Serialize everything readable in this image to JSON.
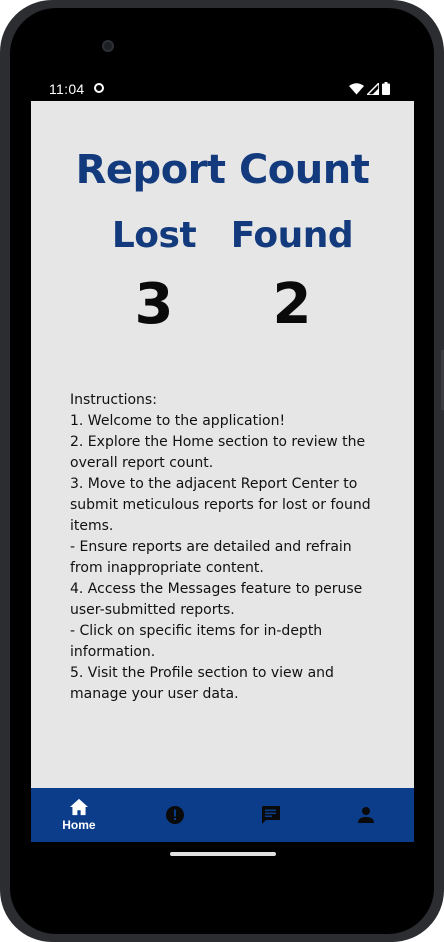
{
  "status_bar": {
    "time": "11:04"
  },
  "main": {
    "title": "Report Count",
    "lost": {
      "label": "Lost",
      "count": "3"
    },
    "found": {
      "label": "Found",
      "count": "2"
    }
  },
  "instructions": {
    "lines": [
      "Instructions:",
      "1. Welcome to the application!",
      "2. Explore the Home section to review the overall report count.",
      "3. Move to the adjacent Report Center to submit meticulous reports for lost or found items.",
      "- Ensure reports are detailed and refrain from inappropriate content.",
      "4. Access the Messages feature to peruse user-submitted reports.",
      "- Click on specific items for in-depth information.",
      "5. Visit the Profile section to view and manage your user data."
    ]
  },
  "bottom_nav": {
    "items": [
      {
        "icon": "home-icon",
        "label": "Home",
        "active": true
      },
      {
        "icon": "report-icon",
        "label": "",
        "active": false
      },
      {
        "icon": "messages-icon",
        "label": "",
        "active": false
      },
      {
        "icon": "profile-icon",
        "label": "",
        "active": false
      }
    ]
  },
  "colors": {
    "accent": "#123a7c",
    "nav_background": "#0b3d8a",
    "screen_background": "#e6e6e6"
  }
}
